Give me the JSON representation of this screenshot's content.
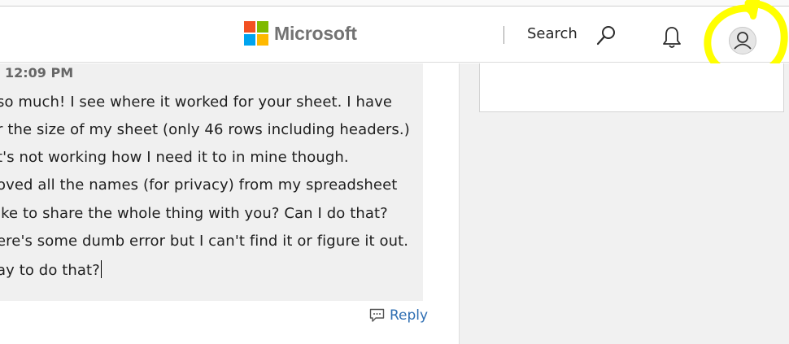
{
  "header": {
    "brand_name": "Microsoft",
    "brand_colors": [
      "#f25022",
      "#7fba00",
      "#00a4ef",
      "#ffb900"
    ],
    "search_label": "Search",
    "icons": [
      "search-icon",
      "bell-icon",
      "user-avatar-icon"
    ],
    "highlight_color": "#ffff00"
  },
  "message": {
    "timestamp": "12:09 PM",
    "lines": [
      "so much! I see where it worked for your sheet. I have",
      "r the size of my sheet (only 46 rows including headers.)",
      "t's not working how I need it to in mine though.",
      "oved all the names (for privacy) from my spreadsheet",
      "ike to share the whole thing with you? Can I do that?",
      "ere's some dumb error but I can't find it or figure it out.",
      "ay to do that?"
    ]
  },
  "actions": {
    "reply_label": "Reply",
    "reply_icon": "comment-icon",
    "link_color": "#2f6fb3"
  }
}
